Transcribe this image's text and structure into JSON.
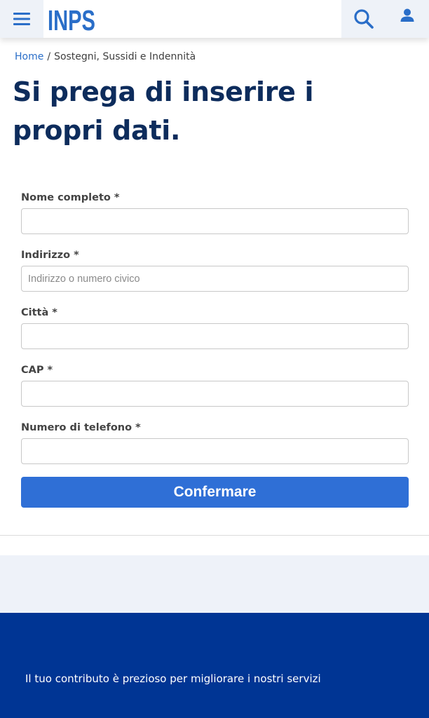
{
  "header": {
    "logo_text": "INPS",
    "menu_icon": "hamburger-menu-icon",
    "search_icon": "search-icon",
    "user_icon": "user-icon",
    "brand_color": "#2a6ec8"
  },
  "breadcrumb": {
    "home": "Home",
    "separator": "/",
    "current": "Sostegni, Sussidi e Indennità"
  },
  "page": {
    "title": "Si prega di inserire i propri dati."
  },
  "form": {
    "fields": [
      {
        "label": "Nome completo *",
        "value": "",
        "placeholder": ""
      },
      {
        "label": "Indirizzo *",
        "value": "",
        "placeholder": "Indirizzo o numero civico"
      },
      {
        "label": "Città *",
        "value": "",
        "placeholder": ""
      },
      {
        "label": "CAP *",
        "value": "",
        "placeholder": ""
      },
      {
        "label": "Numero di telefono *",
        "value": "",
        "placeholder": ""
      }
    ],
    "submit_label": "Confermare",
    "submit_color": "#2f6fd6"
  },
  "footer": {
    "text": "Il tuo contributo è prezioso per migliorare i nostri servizi",
    "background_color": "#003594"
  }
}
